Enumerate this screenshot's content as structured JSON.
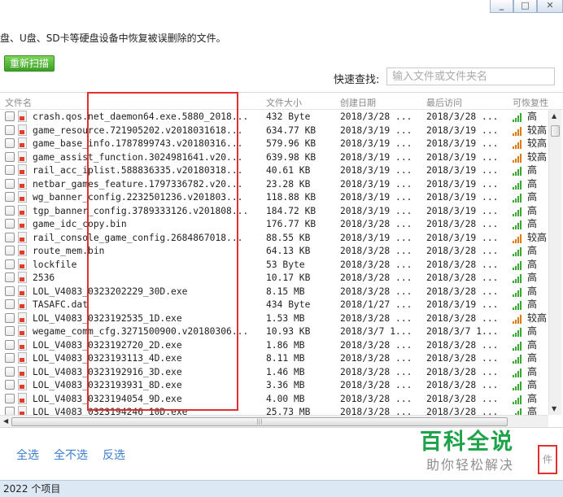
{
  "window": {
    "minimize": "_",
    "maximize": "□",
    "close": "✕"
  },
  "toolbar": {
    "description": "盘、U盘、SD卡等硬盘设备中恢复被误删除的文件。",
    "rescan_label": "重新扫描",
    "quick_search_label": "快速查找:",
    "quick_search_placeholder": "输入文件或文件夹名"
  },
  "table": {
    "columns": {
      "name": "文件名",
      "size": "文件大小",
      "created": "创建日期",
      "accessed": "最后访问",
      "recoverability": "可恢复性"
    },
    "rows": [
      {
        "name": "crash.qos.net_daemon64.exe.5880_2018...",
        "size": "432 Byte",
        "created": "2018/3/28 ...",
        "accessed": "2018/3/28 ...",
        "grade": "高",
        "grade_color": "#3aa832"
      },
      {
        "name": "game_resource.721905202.v2018031618...",
        "size": "634.77 KB",
        "created": "2018/3/19 ...",
        "accessed": "2018/3/19 ...",
        "grade": "较高",
        "grade_color": "#e07a12"
      },
      {
        "name": "game_base_info.1787899743.v20180316...",
        "size": "579.96 KB",
        "created": "2018/3/19 ...",
        "accessed": "2018/3/19 ...",
        "grade": "较高",
        "grade_color": "#e07a12"
      },
      {
        "name": "game_assist_function.3024981641.v20...",
        "size": "639.98 KB",
        "created": "2018/3/19 ...",
        "accessed": "2018/3/19 ...",
        "grade": "较高",
        "grade_color": "#e07a12"
      },
      {
        "name": "rail_acc_iplist.588836335.v20180318...",
        "size": "40.61 KB",
        "created": "2018/3/19 ...",
        "accessed": "2018/3/19 ...",
        "grade": "高",
        "grade_color": "#3aa832"
      },
      {
        "name": "netbar_games_feature.1797336782.v20...",
        "size": "23.28 KB",
        "created": "2018/3/19 ...",
        "accessed": "2018/3/19 ...",
        "grade": "高",
        "grade_color": "#3aa832"
      },
      {
        "name": "wg_banner_config.2232501236.v201803...",
        "size": "118.88 KB",
        "created": "2018/3/19 ...",
        "accessed": "2018/3/19 ...",
        "grade": "高",
        "grade_color": "#3aa832"
      },
      {
        "name": "tgp_banner_config.3789333126.v201808...",
        "size": "184.72 KB",
        "created": "2018/3/19 ...",
        "accessed": "2018/3/19 ...",
        "grade": "高",
        "grade_color": "#3aa832"
      },
      {
        "name": "game_idc_copy.bin",
        "size": "176.77 KB",
        "created": "2018/3/28 ...",
        "accessed": "2018/3/28 ...",
        "grade": "高",
        "grade_color": "#3aa832"
      },
      {
        "name": "rail_console_game_config.2684867018...",
        "size": "88.55 KB",
        "created": "2018/3/19 ...",
        "accessed": "2018/3/19 ...",
        "grade": "较高",
        "grade_color": "#e07a12"
      },
      {
        "name": "route_mem.bin",
        "size": "64.13 KB",
        "created": "2018/3/28 ...",
        "accessed": "2018/3/28 ...",
        "grade": "高",
        "grade_color": "#3aa832"
      },
      {
        "name": "lockfile",
        "size": "53 Byte",
        "created": "2018/3/28 ...",
        "accessed": "2018/3/28 ...",
        "grade": "高",
        "grade_color": "#3aa832"
      },
      {
        "name": "2536",
        "size": "10.17 KB",
        "created": "2018/3/28 ...",
        "accessed": "2018/3/28 ...",
        "grade": "高",
        "grade_color": "#3aa832"
      },
      {
        "name": "LOL_V4083_0323202229_30D.exe",
        "size": "8.15 MB",
        "created": "2018/3/28 ...",
        "accessed": "2018/3/28 ...",
        "grade": "高",
        "grade_color": "#3aa832"
      },
      {
        "name": "TASAFC.dat",
        "size": "434 Byte",
        "created": "2018/1/27 ...",
        "accessed": "2018/3/19 ...",
        "grade": "高",
        "grade_color": "#3aa832"
      },
      {
        "name": "LOL_V4083_0323192535_1D.exe",
        "size": "1.53 MB",
        "created": "2018/3/28 ...",
        "accessed": "2018/3/28 ...",
        "grade": "较高",
        "grade_color": "#e07a12"
      },
      {
        "name": "wegame_comm_cfg.3271500900.v20180306...",
        "size": "10.93 KB",
        "created": "2018/3/7 1...",
        "accessed": "2018/3/7 1...",
        "grade": "高",
        "grade_color": "#3aa832"
      },
      {
        "name": "LOL_V4083_0323192720_2D.exe",
        "size": "1.86 MB",
        "created": "2018/3/28 ...",
        "accessed": "2018/3/28 ...",
        "grade": "高",
        "grade_color": "#3aa832"
      },
      {
        "name": "LOL_V4083_0323193113_4D.exe",
        "size": "8.11 MB",
        "created": "2018/3/28 ...",
        "accessed": "2018/3/28 ...",
        "grade": "高",
        "grade_color": "#3aa832"
      },
      {
        "name": "LOL_V4083_0323192916_3D.exe",
        "size": "1.46 MB",
        "created": "2018/3/28 ...",
        "accessed": "2018/3/28 ...",
        "grade": "高",
        "grade_color": "#3aa832"
      },
      {
        "name": "LOL_V4083_0323193931_8D.exe",
        "size": "3.36 MB",
        "created": "2018/3/28 ...",
        "accessed": "2018/3/28 ...",
        "grade": "高",
        "grade_color": "#3aa832"
      },
      {
        "name": "LOL_V4083_0323194054_9D.exe",
        "size": "4.00 MB",
        "created": "2018/3/28 ...",
        "accessed": "2018/3/28 ...",
        "grade": "高",
        "grade_color": "#3aa832"
      },
      {
        "name": "LOL_V4083_0323194246_10D.exe",
        "size": "25.73 MB",
        "created": "2018/3/28 ...",
        "accessed": "2018/3/28 ...",
        "grade": "高",
        "grade_color": "#3aa832"
      }
    ]
  },
  "scrollbar": {
    "up": "▲",
    "down": "▼",
    "left": "◀",
    "grip": "|||"
  },
  "actions": {
    "select_all": "全选",
    "select_none": "全不选",
    "invert": "反选",
    "recover_partial": "件"
  },
  "watermark": {
    "title": "百科全说",
    "subtitle": "助你轻松解决"
  },
  "status": {
    "item_count": "2022 个项目"
  },
  "colors": {
    "accent_green": "#1ea24a",
    "link_blue": "#3a7ed0",
    "highlight_red": "#e03030",
    "status_bg": "#dde8f5"
  }
}
